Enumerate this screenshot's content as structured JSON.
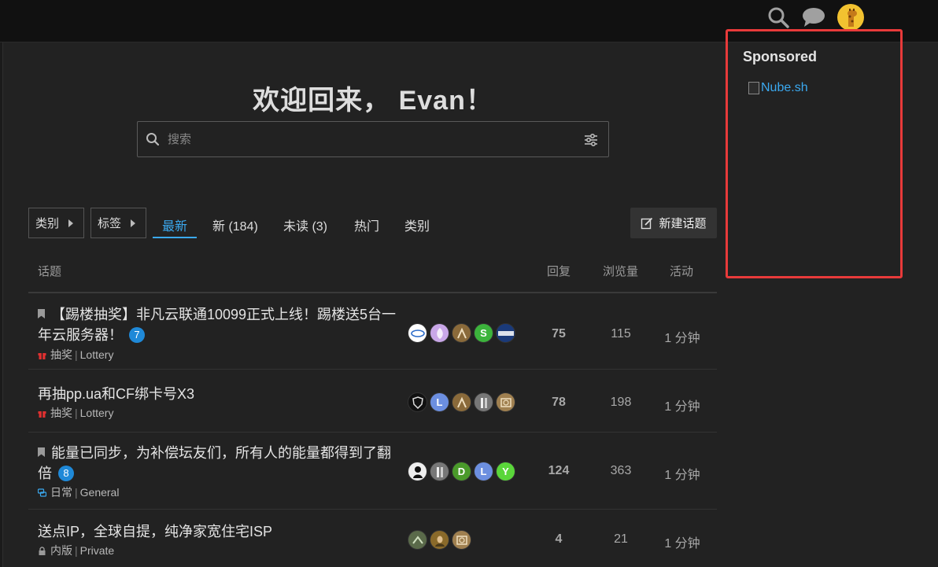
{
  "header": {
    "search_icon": "search-icon",
    "chat_icon": "chat-icon",
    "avatar_icon": "giraffe-avatar"
  },
  "welcome": {
    "title": "欢迎回来， Evan！"
  },
  "search": {
    "placeholder": "搜索"
  },
  "nav": {
    "categories_dropdown": "类别",
    "tags_dropdown": "标签",
    "tabs": [
      "最新",
      "新 (184)",
      "未读 (3)",
      "热门",
      "类别"
    ],
    "active_tab": "最新",
    "new_topic": "新建话题"
  },
  "table": {
    "columns": [
      "话题",
      "回复",
      "浏览量",
      "活动"
    ],
    "rows": [
      {
        "pinned": true,
        "title": "【踢楼抽奖】非凡云联通10099正式上线！踢楼送5台一年云服务器！",
        "badge": "7",
        "category": "抽奖",
        "tag": "Lottery",
        "replies": "75",
        "views": "115",
        "activity": "1 分钟",
        "posters": [
          {
            "letter": "",
            "color": "#ffffff"
          },
          {
            "letter": "",
            "color": "#c9a7e8"
          },
          {
            "letter": "",
            "color": "#8a6a3a"
          },
          {
            "letter": "S",
            "color": "#3cb43c"
          },
          {
            "letter": "",
            "color": "#1a3a7a"
          }
        ]
      },
      {
        "pinned": false,
        "title": "再抽pp.ua和CF绑卡号X3",
        "badge": "",
        "category": "抽奖",
        "tag": "Lottery",
        "replies": "78",
        "views": "198",
        "activity": "1 分钟",
        "posters": [
          {
            "letter": "",
            "color": "#111111"
          },
          {
            "letter": "L",
            "color": "#6c8fe0"
          },
          {
            "letter": "",
            "color": "#8a6a3a"
          },
          {
            "letter": "",
            "color": "#777777"
          },
          {
            "letter": "",
            "color": "#a08050"
          }
        ]
      },
      {
        "pinned": true,
        "title": "能量已同步，为补偿坛友们，所有人的能量都得到了翻倍",
        "badge": "8",
        "category": "日常",
        "tag": "General",
        "replies": "124",
        "views": "363",
        "activity": "1 分钟",
        "posters": [
          {
            "letter": "",
            "color": "#eeeeee"
          },
          {
            "letter": "",
            "color": "#777777"
          },
          {
            "letter": "D",
            "color": "#4a9a2a"
          },
          {
            "letter": "L",
            "color": "#6c8fe0"
          },
          {
            "letter": "Y",
            "color": "#5ad63a"
          }
        ]
      },
      {
        "pinned": false,
        "title": "送点IP，全球自提，纯净家宽住宅ISP",
        "badge": "",
        "category": "内版",
        "tag": "Private",
        "replies": "4",
        "views": "21",
        "activity": "1 分钟",
        "posters": [
          {
            "letter": "",
            "color": "#5a6a4a"
          },
          {
            "letter": "",
            "color": "#8a6a2a"
          },
          {
            "letter": "",
            "color": "#a08050"
          }
        ]
      }
    ]
  },
  "sponsored": {
    "title": "Sponsored",
    "link_text": "Nube.sh"
  },
  "colors": {
    "accent": "#3ba9f0",
    "badge": "#1f89d8",
    "highlight_border": "#e83a3a",
    "lottery_icon": "#e03030",
    "general_icon": "#3ba9f0"
  }
}
